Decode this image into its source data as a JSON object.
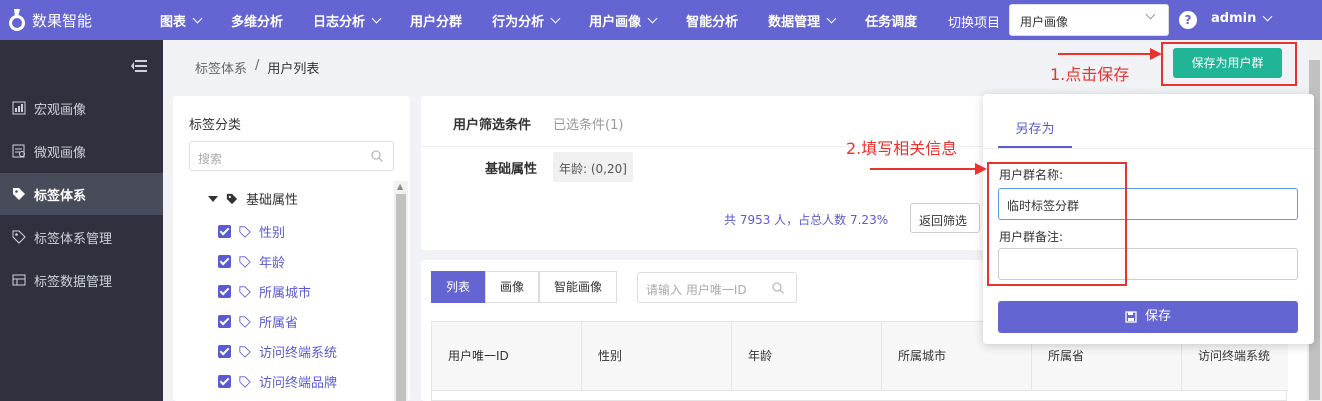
{
  "app": {
    "logo_text": "数果智能"
  },
  "nav": {
    "items": [
      {
        "label": "图表",
        "dropdown": true
      },
      {
        "label": "多维分析",
        "dropdown": false
      },
      {
        "label": "日志分析",
        "dropdown": true
      },
      {
        "label": "用户分群",
        "dropdown": false
      },
      {
        "label": "行为分析",
        "dropdown": true
      },
      {
        "label": "用户画像",
        "dropdown": true
      },
      {
        "label": "智能分析",
        "dropdown": false
      },
      {
        "label": "数据管理",
        "dropdown": true
      },
      {
        "label": "任务调度",
        "dropdown": false
      }
    ],
    "switch_project_label": "切换项目",
    "project_select_value": "用户画像",
    "help_icon": "?",
    "user_name": "admin"
  },
  "sidebar": {
    "items": [
      {
        "label": "宏观画像",
        "icon": "chart-icon",
        "active": false
      },
      {
        "label": "微观画像",
        "icon": "profile-icon",
        "active": false
      },
      {
        "label": "标签体系",
        "icon": "tag-icon",
        "active": true
      },
      {
        "label": "标签体系管理",
        "icon": "tag-settings-icon",
        "active": false
      },
      {
        "label": "标签数据管理",
        "icon": "data-icon",
        "active": false
      }
    ]
  },
  "breadcrumb": {
    "parent": "标签体系",
    "separator": "/",
    "current": "用户列表"
  },
  "toolbar": {
    "save_group_label": "保存为用户群"
  },
  "annotations": {
    "step1": "1.点击保存",
    "step2": "2.填写相关信息"
  },
  "left_panel": {
    "title": "标签分类",
    "search_placeholder": "搜索",
    "root_label": "基础属性",
    "items": [
      "性别",
      "年龄",
      "所属城市",
      "所属省",
      "访问终端系统",
      "访问终端品牌"
    ]
  },
  "filter": {
    "title": "用户筛选条件",
    "selected_count_label": "已选条件(1)",
    "basic_label": "基础属性",
    "chip": "年龄: (0,20]",
    "stats": "共 7953 人，占总人数 7.23%",
    "back_label": "返回筛选"
  },
  "list": {
    "tabs": [
      "列表",
      "画像",
      "智能画像"
    ],
    "active_tab": 0,
    "search_placeholder": "请输入 用户唯一ID",
    "columns": [
      "用户唯一ID",
      "性别",
      "年龄",
      "所属城市",
      "所属省",
      "访问终端系统"
    ]
  },
  "popover": {
    "tab_label": "另存为",
    "name_label": "用户群名称:",
    "name_value": "临时标签分群",
    "remark_label": "用户群备注:",
    "remark_value": "",
    "save_label": "保存"
  },
  "colors": {
    "brand": "#6464d2",
    "accent_green": "#1fb596",
    "annotation_red": "#e8332f"
  }
}
